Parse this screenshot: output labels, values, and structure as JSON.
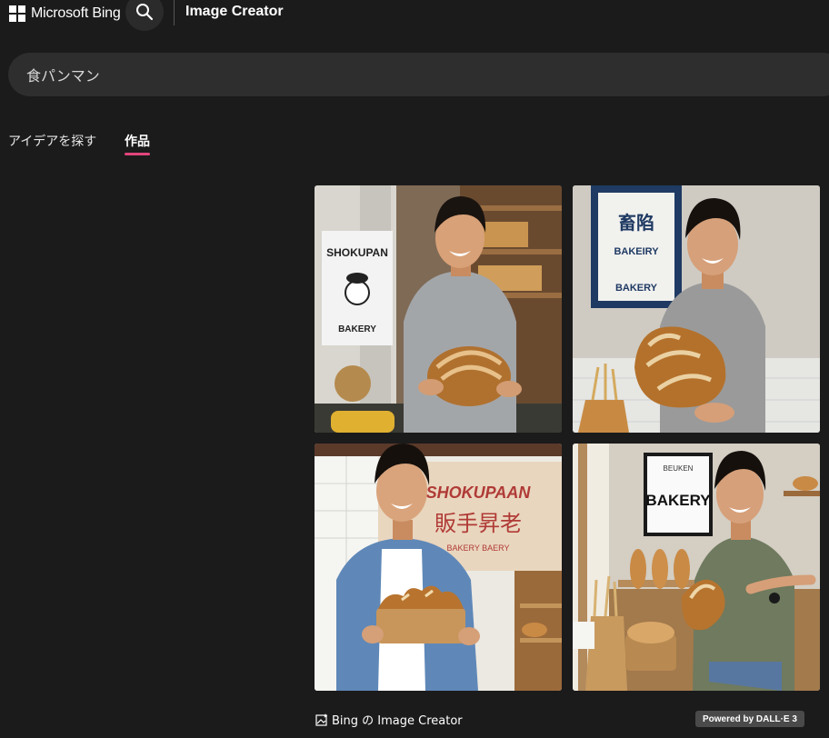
{
  "header": {
    "brand": "Microsoft Bing",
    "product_title": "Image Creator"
  },
  "prompt": {
    "value": "食パンマン"
  },
  "tabs": [
    {
      "label": "アイデアを探す",
      "active": false
    },
    {
      "label": "作品",
      "active": true
    }
  ],
  "accent_color": "#e0457b",
  "images": [
    {
      "sign_title": "SHOKUPAN",
      "sign_subtitle": "BAKERY"
    },
    {
      "sign_title": "BAKEIRY",
      "sign_subtitle": "BAKERY",
      "sign_kanji": "畜陷"
    },
    {
      "sign_title": "SHOKUPAAN",
      "sign_subtitle": "BAKERY BAERY",
      "sign_kanji": "販手昇老"
    },
    {
      "sign_title": "BAKERY",
      "sign_top": "BEUKEN"
    }
  ],
  "footer": {
    "brand_label": "Bing の Image Creator",
    "powered_label": "Powered by DALL·E 3"
  }
}
